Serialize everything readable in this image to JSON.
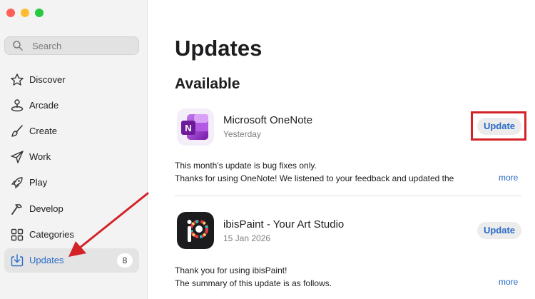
{
  "window": {
    "controls": [
      "close",
      "minimize",
      "zoom"
    ],
    "colors": [
      "#ff5f57",
      "#febc2e",
      "#28c840"
    ]
  },
  "sidebar": {
    "search": {
      "placeholder": "Search"
    },
    "items": [
      {
        "label": "Discover",
        "icon": "star-icon"
      },
      {
        "label": "Arcade",
        "icon": "joystick-icon"
      },
      {
        "label": "Create",
        "icon": "paintbrush-icon"
      },
      {
        "label": "Work",
        "icon": "paperplane-icon"
      },
      {
        "label": "Play",
        "icon": "rocket-icon"
      },
      {
        "label": "Develop",
        "icon": "hammer-icon"
      },
      {
        "label": "Categories",
        "icon": "grid-icon"
      },
      {
        "label": "Updates",
        "icon": "download-tray-icon",
        "badge": "8",
        "active": true
      }
    ]
  },
  "main": {
    "title": "Updates",
    "section": "Available",
    "apps": [
      {
        "name": "Microsoft OneNote",
        "date": "Yesterday",
        "button": "Update",
        "notes": [
          "This month's update is bug fixes only.",
          "Thanks for using OneNote! We listened to your feedback and updated the"
        ],
        "more": "more",
        "icon": "onenote-icon"
      },
      {
        "name": "ibisPaint - Your Art Studio",
        "date": "15 Jan 2026",
        "button": "Update",
        "notes": [
          "Thank you for using ibisPaint!",
          "The summary of this update is as follows."
        ],
        "more": "more",
        "icon": "ibispaint-icon"
      }
    ]
  },
  "colors": {
    "accent": "#2a6bc7",
    "annotation": "#d42128"
  }
}
